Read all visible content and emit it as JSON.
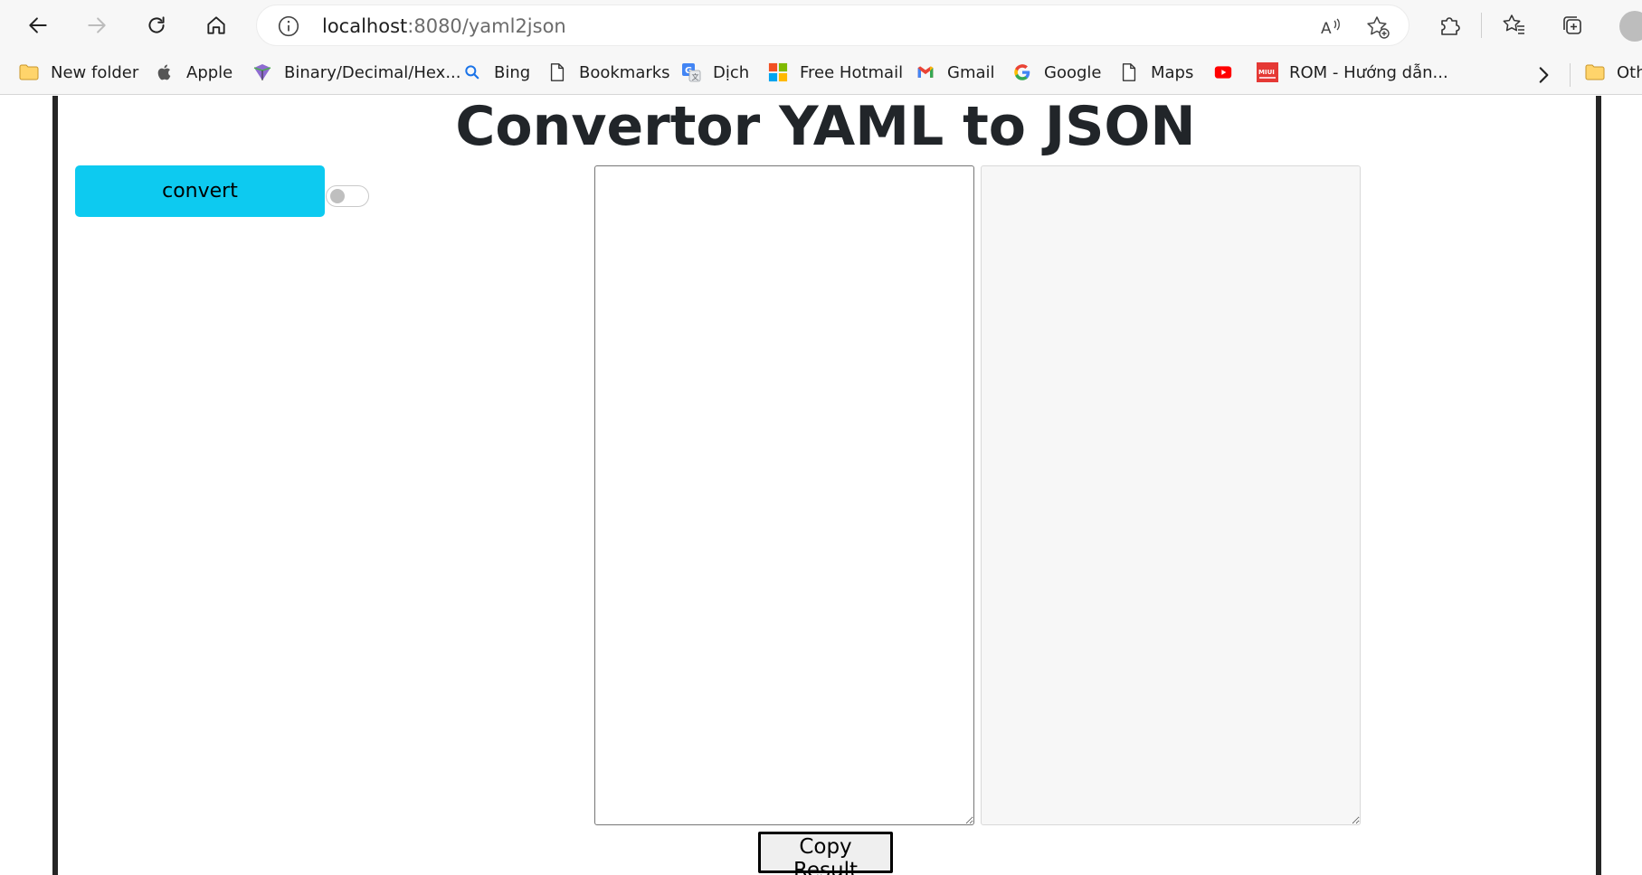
{
  "browser": {
    "address": {
      "host": "localhost",
      "rest": ":8080/yaml2json"
    },
    "bookmarks": [
      {
        "label": "New folder",
        "icon": "folder-icon"
      },
      {
        "label": "Apple",
        "icon": "apple-icon"
      },
      {
        "label": "Binary/Decimal/Hex...",
        "icon": "calculator-icon"
      },
      {
        "label": "Bing",
        "icon": "search-icon"
      },
      {
        "label": "Bookmarks",
        "icon": "page-icon"
      },
      {
        "label": "Dịch",
        "icon": "translate-icon"
      },
      {
        "label": "Free Hotmail",
        "icon": "microsoft-icon"
      },
      {
        "label": "Gmail",
        "icon": "gmail-icon"
      },
      {
        "label": "Google",
        "icon": "google-icon"
      },
      {
        "label": "Maps",
        "icon": "page-icon"
      },
      {
        "label": "",
        "icon": "youtube-icon"
      },
      {
        "label": "ROM - Hướng dẫn...",
        "icon": "miui-icon"
      },
      {
        "label": "Oth",
        "icon": "folder-icon"
      }
    ]
  },
  "page": {
    "title": "Convertor YAML to JSON",
    "convert_label": "convert",
    "toggle_on": false,
    "yaml_input_value": "",
    "json_output_value": "",
    "copy_label": "Copy Result"
  },
  "colors": {
    "convert_button": "#0dcaf0",
    "frame_border": "#262626",
    "output_bg": "#f7f7f7"
  }
}
